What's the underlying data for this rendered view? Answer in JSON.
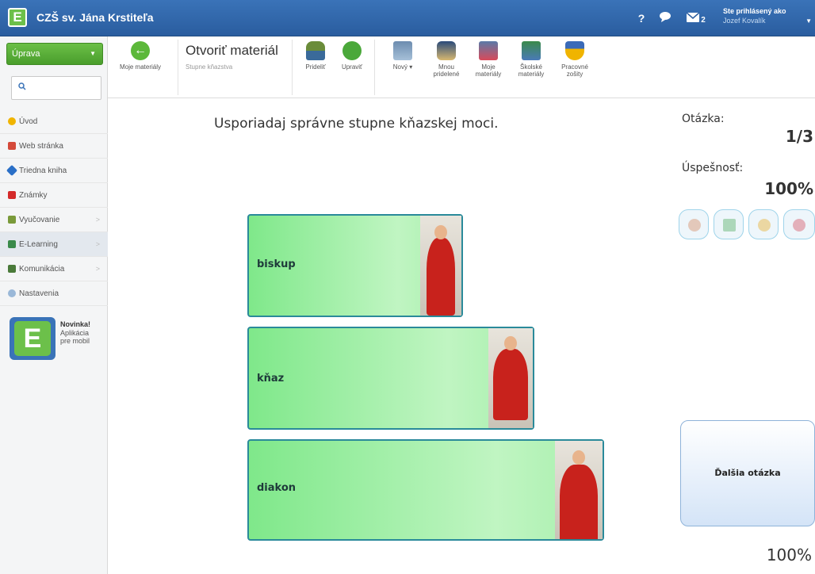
{
  "header": {
    "school_name": "CZŠ sv. Jána Krstiteľa",
    "help": "?",
    "mail_count": "2",
    "user_label": "Ste prihlásený ako",
    "user_name": "Jozef Kovalík"
  },
  "sidebar": {
    "edit_label": "Úprava",
    "items": [
      {
        "label": "Úvod",
        "icon": "star-icon",
        "color": "#f0b400"
      },
      {
        "label": "Web stránka",
        "icon": "web-icon",
        "color": "#d44a3a"
      },
      {
        "label": "Triedna kniha",
        "icon": "book-icon",
        "color": "#2a6fc7"
      },
      {
        "label": "Známky",
        "icon": "grades-icon",
        "color": "#d42a2a"
      },
      {
        "label": "Vyučovanie",
        "icon": "teaching-icon",
        "color": "#7a9a3a"
      },
      {
        "label": "E-Learning",
        "icon": "elearning-icon",
        "color": "#3a8a4a"
      },
      {
        "label": "Komunikácia",
        "icon": "communication-icon",
        "color": "#4a7a3a"
      },
      {
        "label": "Nastavenia",
        "icon": "settings-icon",
        "color": "#9ab8d8"
      }
    ],
    "promo": {
      "title": "Novinka!",
      "line1": "Aplikácia",
      "line2": "pre mobil",
      "logo": "E"
    }
  },
  "toolbar": {
    "back_label": "Moje materiály",
    "title": "Otvoriť materiál",
    "subtitle": "Stupne kňazstva",
    "assign_label": "Prideliť",
    "edit_label": "Upraviť",
    "new_label": "Nový",
    "shared_label_1": "Mnou",
    "shared_label_2": "pridelené",
    "my_label_1": "Moje",
    "my_label_2": "materiály",
    "school_label_1": "Školské",
    "school_label_2": "materiály",
    "workbook_label_1": "Pracovné",
    "workbook_label_2": "zošity"
  },
  "quiz": {
    "question": "Usporiadaj správne stupne kňazskej moci.",
    "cards": [
      {
        "label": "biskup"
      },
      {
        "label": "kňaz"
      },
      {
        "label": "diakon"
      }
    ],
    "question_label": "Otázka:",
    "question_value": "1/3",
    "success_label": "Úspešnosť:",
    "success_value": "100%",
    "next_label": "Ďalšia otázka",
    "bottom_percent": "100%"
  }
}
